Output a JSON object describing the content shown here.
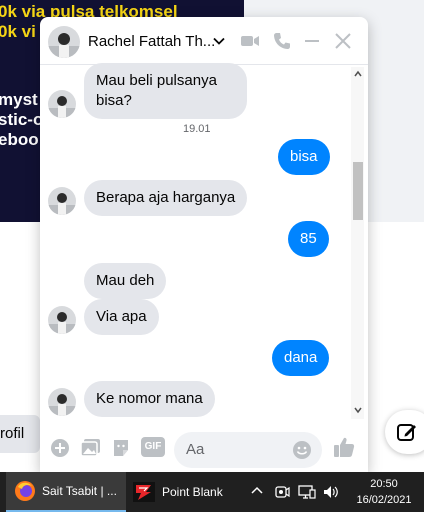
{
  "background": {
    "promo_lines": [
      "0k via pulsa telkomsel",
      "0k vi"
    ],
    "dark_lines": [
      "myst",
      "stic-o",
      "eboo"
    ],
    "profile_label": "rofil"
  },
  "chat": {
    "contact_name": "Rachel Fattah Th...",
    "messages": [
      {
        "dir": "in",
        "lines": [
          "Mau beli pulsanya",
          "bisa?"
        ]
      },
      {
        "timestamp": "19.01"
      },
      {
        "dir": "out",
        "text": "bisa"
      },
      {
        "dir": "in",
        "text": "Berapa aja harganya"
      },
      {
        "dir": "out",
        "text": "85"
      },
      {
        "dir": "in",
        "text": "Mau deh"
      },
      {
        "dir": "in",
        "text": "Via apa"
      },
      {
        "dir": "out",
        "text": "dana"
      },
      {
        "dir": "in",
        "text": "Ke nomor mana"
      }
    ],
    "composer": {
      "placeholder": "Aa",
      "gif_label": "GIF"
    }
  },
  "taskbar": {
    "apps": [
      {
        "label": "Sait Tsabit | ...",
        "icon": "firefox-icon"
      },
      {
        "label": "Point Blank",
        "icon": "point-blank-icon"
      }
    ],
    "clock": {
      "time": "20:50",
      "date": "16/02/2021"
    }
  },
  "colors": {
    "messenger_blue": "#0084ff",
    "incoming_bubble": "#e4e6eb",
    "taskbar": "#202020",
    "promo_yellow": "#f5d515"
  }
}
